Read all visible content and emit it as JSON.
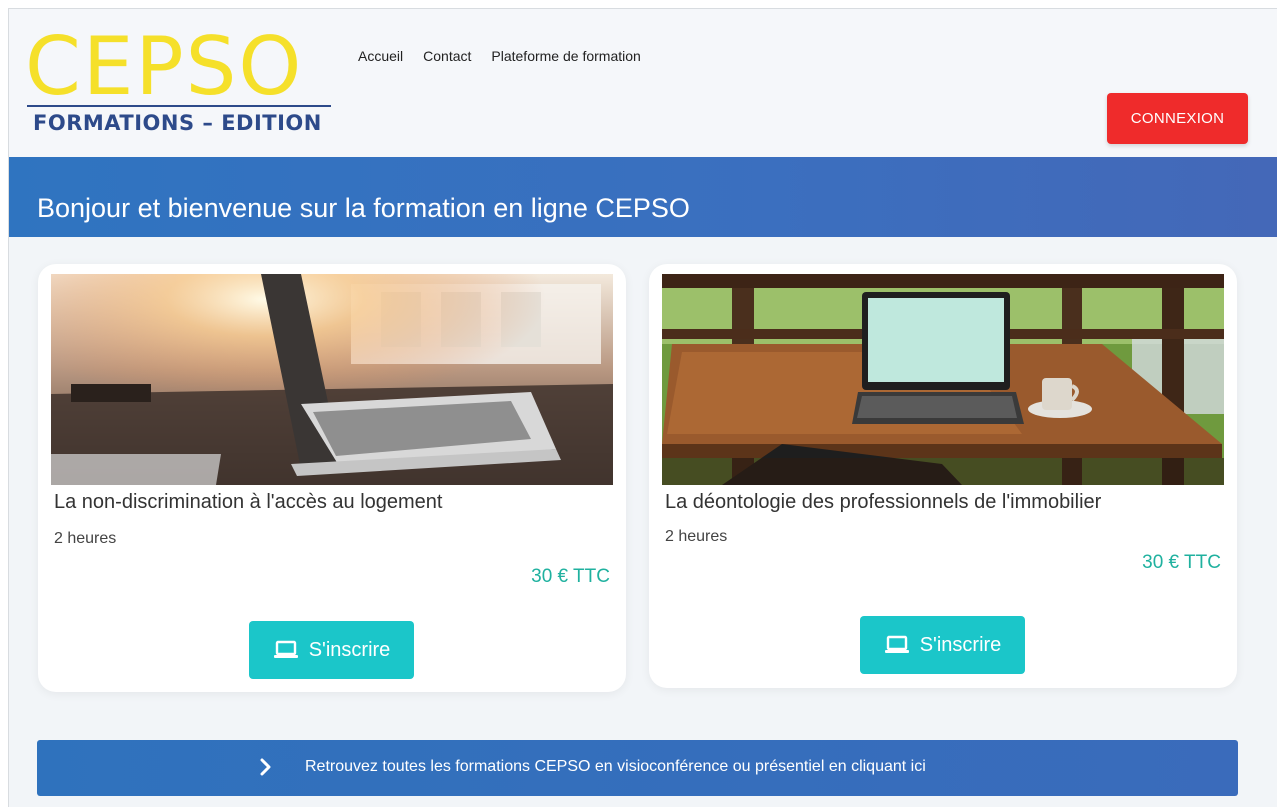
{
  "header": {
    "logo_main": "CEPSO",
    "logo_sub": "FORMATIONS – EDITION",
    "nav": [
      "Accueil",
      "Contact",
      "Plateforme de formation"
    ],
    "login_label": "CONNEXION"
  },
  "banner": {
    "title": "Bonjour et bienvenue sur la formation en ligne CEPSO"
  },
  "courses": [
    {
      "title": "La non-discrimination à l'accès au logement",
      "duration": "2 heures",
      "price": "30 € TTC",
      "button_label": "S'inscrire",
      "button_icon": "laptop-icon",
      "image": "laptop-sunlight-photo"
    },
    {
      "title": "La déontologie des professionnels de l'immobilier",
      "duration": "2 heures",
      "price": "30 € TTC",
      "button_label": "S'inscrire",
      "button_icon": "laptop-icon",
      "image": "laptop-terrace-photo"
    }
  ],
  "footer_bar": {
    "icon": "chevron-right-icon",
    "text": "Retrouvez toutes les formations CEPSO en visioconférence ou présentiel en cliquant ici"
  },
  "colors": {
    "logo_yellow": "#f5e02a",
    "logo_blue": "#2d4a8a",
    "banner_blue": "#2f74c0",
    "login_red": "#ef2b2b",
    "price_green": "#1fb19f",
    "button_cyan": "#1bc6c9"
  }
}
